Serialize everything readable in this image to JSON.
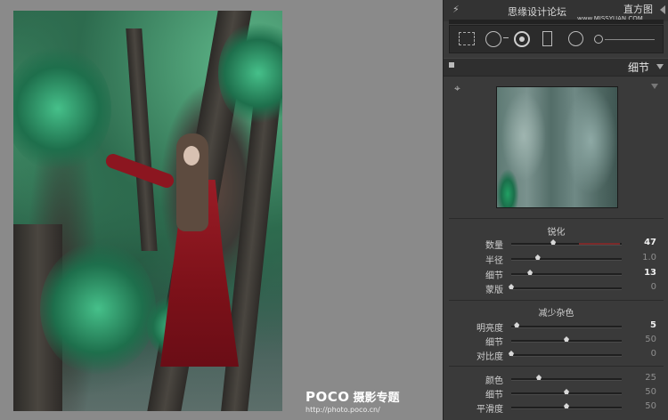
{
  "panel": {
    "histogram_label": "直方图",
    "site_watermark": "思缘设计论坛",
    "site_url": "www.MISSYUAN.COM"
  },
  "section": {
    "title": "细节"
  },
  "sharpening": {
    "title": "锐化",
    "rows": [
      {
        "label": "数量",
        "value": "47",
        "level": 0.38,
        "active": true
      },
      {
        "label": "半径",
        "value": "1.0",
        "level": 0.24,
        "active": false
      },
      {
        "label": "细节",
        "value": "13",
        "level": 0.17,
        "active": true
      },
      {
        "label": "蒙版",
        "value": "0",
        "level": 0.0,
        "active": false
      }
    ]
  },
  "noise_reduction": {
    "title": "减少杂色",
    "rows": [
      {
        "label": "明亮度",
        "value": "5",
        "level": 0.05,
        "active": true
      },
      {
        "label": "细节",
        "value": "50",
        "level": 0.5,
        "active": false
      },
      {
        "label": "对比度",
        "value": "0",
        "level": 0.0,
        "active": false
      },
      {
        "label": "颜色",
        "value": "25",
        "level": 0.25,
        "active": false
      },
      {
        "label": "细节",
        "value": "50",
        "level": 0.5,
        "active": false
      },
      {
        "label": "平滑度",
        "value": "50",
        "level": 0.5,
        "active": false
      }
    ]
  },
  "watermark": {
    "logo": "POCO",
    "subtitle": "摄影专题",
    "url": "http://photo.poco.cn/"
  },
  "icons": [
    "bolt-icon",
    "collapse-arrow-icon",
    "crop-overlay-icon",
    "spot-removal-icon",
    "red-eye-icon",
    "graduated-filter-icon",
    "radial-filter-icon",
    "adjustment-brush-icon",
    "panel-toggle-icon",
    "section-collapse-icon",
    "target-adjust-icon",
    "preview-menu-icon"
  ]
}
